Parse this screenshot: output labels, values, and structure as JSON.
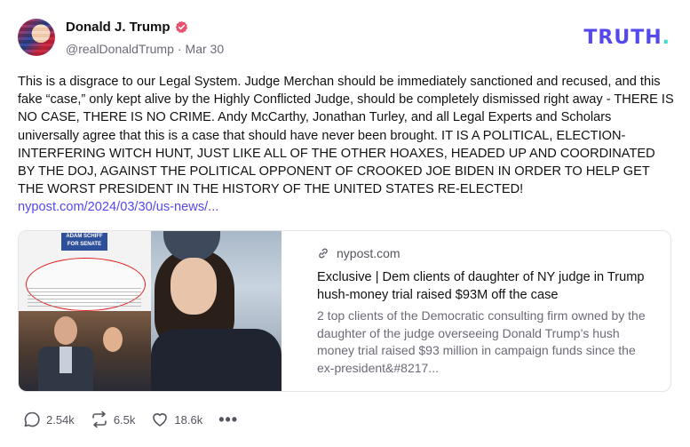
{
  "author": {
    "name": "Donald J. Trump",
    "handle": "@realDonaldTrump",
    "separator": "·",
    "date": "Mar 30"
  },
  "brand": {
    "logo_text": "TRUTH",
    "logo_dot": ".",
    "accent_color": "#5448ee",
    "dot_color": "#3ddcc7",
    "verified_color": "#e8506b"
  },
  "post": {
    "text": "This is a disgrace to our Legal System. Judge Merchan should be immediately sanctioned and recused, and this fake “case,” only kept alive by the Highly Conflicted Judge, should be completely dismissed right away - THERE IS NO CASE, THERE IS NO CRIME. Andy McCarthy, Jonathan Turley, and all Legal Experts and Scholars universally agree that this is a case that should have never been brought. IT IS A POLITICAL, ELECTION-INTERFERING WITCH HUNT, JUST LIKE ALL OF THE OTHER HOAXES, HEADED UP AND COORDINATED BY THE DOJ, AGAINST THE POLITICAL OPPONENT OF CROOKED JOE BIDEN IN ORDER TO HELP GET THE WORST PRESIDENT IN THE HISTORY OF THE UNITED STATES RE-ELECTED! ",
    "link_text": "nypost.com/2024/03/30/us-news/..."
  },
  "card": {
    "source": "nypost.com",
    "title": "Exclusive | Dem clients of daughter of NY judge in Trump hush-money trial raised $93M off the case",
    "description": "2 top clients of the Democratic consulting firm owned by the daughter of the judge overseeing Donald Trump’s hush money trial raised $93 million in campaign funds since the ex-president&#8217...",
    "image_banner": "ADAM SCHIFF FOR SENATE"
  },
  "actions": {
    "replies": "2.54k",
    "retruths": "6.5k",
    "likes": "18.6k",
    "more": "•••"
  }
}
